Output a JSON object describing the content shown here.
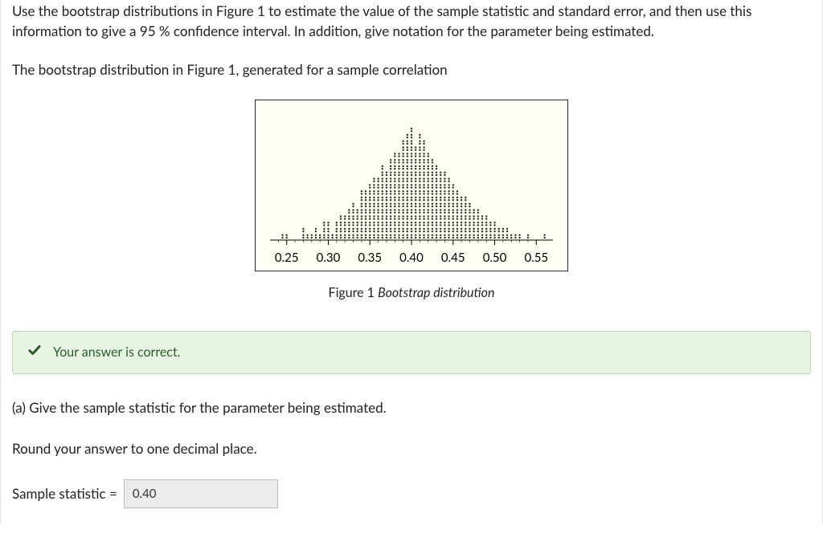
{
  "question": {
    "intro1": "Use the bootstrap distributions in Figure 1 to estimate the value of the sample statistic and standard error, and then use this information to give a 95 %  confidence interval. In addition, give notation for the parameter being estimated.",
    "intro2": "The bootstrap distribution in Figure 1, generated for a sample correlation"
  },
  "figure": {
    "caption_prefix": "Figure 1 ",
    "caption_title": "Bootstrap distribution",
    "tick_labels": [
      "0.25",
      "0.30",
      "0.35",
      "0.40",
      "0.45",
      "0.50",
      "0.55"
    ]
  },
  "chart_data": {
    "type": "dotplot",
    "title": "Bootstrap distribution",
    "xlabel": "",
    "ylabel": "",
    "xlim": [
      0.23,
      0.57
    ],
    "bins_x": [
      0.245,
      0.25,
      0.26,
      0.265,
      0.27,
      0.275,
      0.28,
      0.285,
      0.29,
      0.295,
      0.3,
      0.305,
      0.31,
      0.315,
      0.32,
      0.325,
      0.33,
      0.335,
      0.34,
      0.345,
      0.35,
      0.355,
      0.36,
      0.365,
      0.37,
      0.375,
      0.38,
      0.385,
      0.39,
      0.395,
      0.4,
      0.405,
      0.41,
      0.415,
      0.42,
      0.425,
      0.43,
      0.435,
      0.44,
      0.445,
      0.45,
      0.455,
      0.46,
      0.465,
      0.47,
      0.475,
      0.48,
      0.485,
      0.49,
      0.495,
      0.5,
      0.505,
      0.51,
      0.515,
      0.52,
      0.525,
      0.53,
      0.535,
      0.54,
      0.545,
      0.55,
      0.555,
      0.56
    ],
    "counts": [
      1,
      1,
      0,
      0,
      2,
      1,
      1,
      2,
      1,
      3,
      3,
      1,
      3,
      4,
      4,
      5,
      6,
      5,
      8,
      8,
      9,
      10,
      10,
      12,
      11,
      13,
      14,
      14,
      16,
      17,
      18,
      15,
      17,
      16,
      14,
      13,
      12,
      11,
      11,
      10,
      9,
      8,
      7,
      7,
      6,
      5,
      5,
      4,
      4,
      3,
      3,
      2,
      2,
      2,
      1,
      1,
      1,
      0,
      1,
      0,
      0,
      0,
      1
    ],
    "approximate": true
  },
  "feedback": {
    "text": "Your answer is correct."
  },
  "part_a": {
    "prompt": "(a) Give the sample statistic for the parameter being estimated.",
    "round_note": "Round your answer to one decimal place.",
    "label": "Sample statistic  =",
    "value": "0.40"
  },
  "colors": {
    "feedback_bg": "#e7f3e3",
    "feedback_border": "#badaaf",
    "feedback_text": "#2a5d26",
    "plot_bg": "#fffff5",
    "input_bg": "#ececec"
  }
}
